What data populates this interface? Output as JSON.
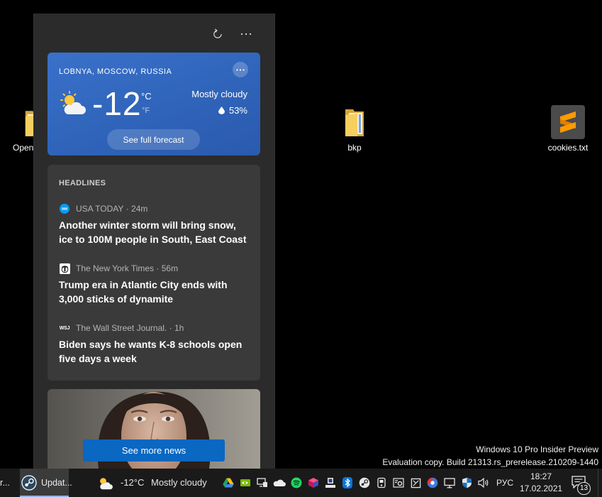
{
  "desktop": {
    "icons": [
      {
        "label": "Open",
        "icon": "folder-icon"
      },
      {
        "label": "bkp",
        "icon": "folder-icon"
      },
      {
        "label": "cookies.txt",
        "icon": "sublime-text-icon"
      }
    ],
    "watermark": {
      "line1": "Windows 10 Pro Insider Preview",
      "line2": "Evaluation copy. Build 21313.rs_prerelease.210209-1440"
    }
  },
  "widget": {
    "toolbar": {
      "refresh_icon": "refresh-icon",
      "more_icon": "more-options-icon"
    },
    "weather": {
      "location": "LOBNYA, MOSCOW, RUSSIA",
      "icon": "sun-behind-cloud-icon",
      "temperature": "-12",
      "unit_c": "°C",
      "unit_f": "°F",
      "condition": "Mostly cloudy",
      "humidity": "53%",
      "forecast_button": "See full forecast",
      "card_color": "#2f64ba"
    },
    "headlines": {
      "title": "HEADLINES",
      "items": [
        {
          "source_icon": "usa-today-logo-icon",
          "source": "USA TODAY",
          "age": "24m",
          "headline": "Another winter storm will bring snow, ice to 100M people in South, East Coast"
        },
        {
          "source_icon": "nyt-logo-icon",
          "source": "The New York Times",
          "age": "56m",
          "headline": "Trump era in Atlantic City ends with 3,000 sticks of dynamite"
        },
        {
          "source_icon": "wsj-logo-icon",
          "logo_text": "WSJ",
          "source": "The Wall Street Journal.",
          "age": "1h",
          "headline": "Biden says he wants K-8 schools open five days a week"
        }
      ]
    },
    "more_news_button": "See more news",
    "accent": "#0a67c2"
  },
  "taskbar": {
    "apps": [
      {
        "label": "r...",
        "active": false
      },
      {
        "label": "Updat...",
        "icon": "steam-icon",
        "active": true
      }
    ],
    "weather": {
      "icon": "sun-behind-cloud-icon",
      "temperature": "-12°C",
      "condition": "Mostly cloudy"
    },
    "tray_icons": [
      "google-drive-icon",
      "nvidia-icon",
      "display-app-icon",
      "onedrive-icon",
      "spotify-icon",
      "cube-app-icon",
      "app-tray-icon",
      "bluetooth-icon",
      "steam-icon",
      "device-icon",
      "settings-tray-icon",
      "square-app-icon",
      "red-blue-app-icon",
      "network-icon",
      "defender-shield-icon",
      "volume-icon"
    ],
    "language": "РУС",
    "time": "18:27",
    "date": "17.02.2021",
    "notification_count": "13"
  }
}
